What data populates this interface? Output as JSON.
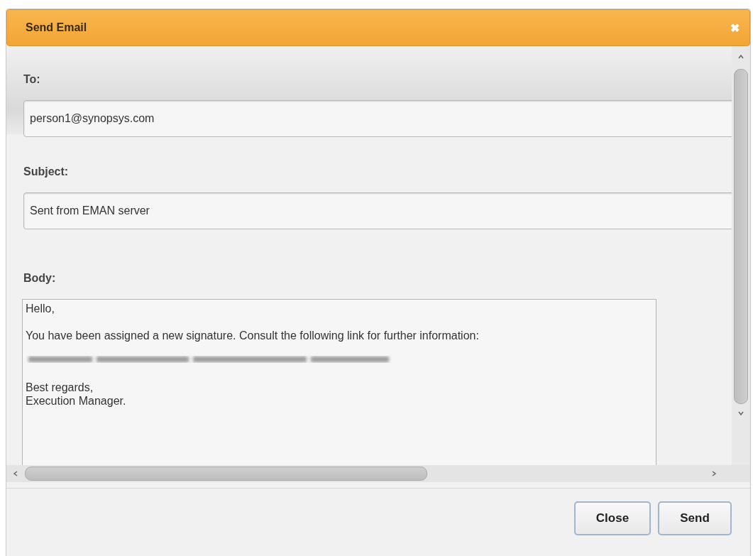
{
  "dialog": {
    "title": "Send Email",
    "close_icon": "✖"
  },
  "fields": [
    {
      "label": "To:",
      "value": "person1@synopsys.com"
    },
    {
      "label": "Subject:",
      "value": "Sent from EMAN server"
    }
  ],
  "body": {
    "label": "Body:",
    "lines": [
      {
        "kind": "text",
        "text": "Hello,"
      },
      {
        "kind": "text",
        "text": "You have been assigned a new signature. Consult the following link for further information:"
      },
      {
        "kind": "redacted"
      },
      {
        "kind": "text",
        "text": "Best regards,\nExecution Manager."
      }
    ]
  },
  "buttons": [
    "Close",
    "Send"
  ]
}
